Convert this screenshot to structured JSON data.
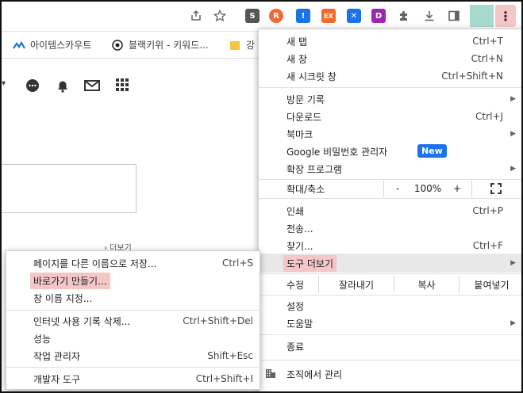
{
  "toolbar": {
    "icons": [
      "share-icon",
      "star-icon",
      "extensions-icon",
      "download-icon",
      "side-panel-icon",
      "more-vert-icon"
    ],
    "extensions": [
      {
        "name": "s-extension-icon",
        "glyph": "S",
        "color": "#555555"
      },
      {
        "name": "rss-extension-icon",
        "glyph": "R",
        "color": "#f06a35"
      },
      {
        "name": "shield-extension-icon",
        "glyph": "!",
        "color": "#1a73e8"
      },
      {
        "name": "ex-extension-icon",
        "glyph": "EX",
        "color": "#f26b2a"
      },
      {
        "name": "cross-extension-icon",
        "glyph": "✕",
        "color": "#1a73e8"
      },
      {
        "name": "d-extension-icon",
        "glyph": "D",
        "color": "#9c27b0"
      }
    ],
    "menu_glyph": "⋮"
  },
  "bookmarks": {
    "items": [
      {
        "label": "아이템스카우트"
      },
      {
        "label": "블랙키위 - 키워드..."
      },
      {
        "label": "강"
      }
    ]
  },
  "menu": {
    "new_tab": {
      "label": "새 탭",
      "shortcut": "Ctrl+T"
    },
    "new_window": {
      "label": "새 창",
      "shortcut": "Ctrl+N"
    },
    "new_incognito": {
      "label": "새 시크릿 창",
      "shortcut": "Ctrl+Shift+N"
    },
    "history": {
      "label": "방문 기록"
    },
    "downloads": {
      "label": "다운로드",
      "shortcut": "Ctrl+J"
    },
    "bookmarks": {
      "label": "북마크"
    },
    "password_manager": {
      "label": "Google 비밀번호 관리자",
      "badge": "New"
    },
    "extensions": {
      "label": "확장 프로그램"
    },
    "zoom": {
      "label": "확대/축소",
      "minus": "-",
      "value": "100%",
      "plus": "+"
    },
    "print": {
      "label": "인쇄",
      "shortcut": "Ctrl+P"
    },
    "cast": {
      "label": "전송..."
    },
    "find": {
      "label": "찾기...",
      "shortcut": "Ctrl+F"
    },
    "more_tools": {
      "label": "도구 더보기"
    },
    "edit": {
      "label": "수정",
      "cut": "잘라내기",
      "copy": "복사",
      "paste": "붙여넣기"
    },
    "settings": {
      "label": "설정"
    },
    "help": {
      "label": "도움말"
    },
    "exit": {
      "label": "종료"
    },
    "managed": {
      "label": "조직에서 관리"
    }
  },
  "submenu": {
    "save_page": {
      "label": "페이지를 다른 이름으로 저장...",
      "shortcut": "Ctrl+S"
    },
    "create_shortcut": {
      "label": "바로가기 만들기..."
    },
    "name_window": {
      "label": "창 이름 지정..."
    },
    "clear_data": {
      "label": "인터넷 사용 기록 삭제...",
      "shortcut": "Ctrl+Shift+Del"
    },
    "performance": {
      "label": "성능"
    },
    "task_manager": {
      "label": "작업 관리자",
      "shortcut": "Shift+Esc"
    },
    "dev_tools": {
      "label": "개발자 도구",
      "shortcut": "Ctrl+Shift+I"
    }
  },
  "page": {
    "more_link": "더보기"
  },
  "colors": {
    "highlight": "#f4c6c6",
    "badge": "#1a73e8",
    "profile": "#a7d9cf"
  }
}
